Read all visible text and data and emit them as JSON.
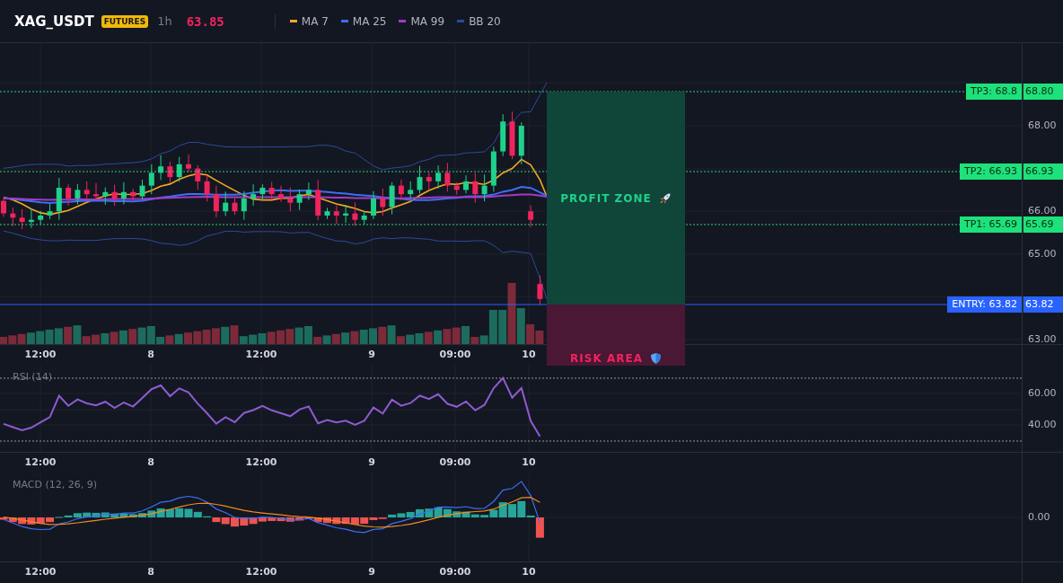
{
  "header": {
    "symbol": "XAG_USDT",
    "market_badge": "FUTURES",
    "interval": "1h",
    "price": {
      "value": "63.85",
      "falling": true
    }
  },
  "legend": [
    {
      "label": "MA 7",
      "color": "#f5a623"
    },
    {
      "label": "MA 25",
      "color": "#3d6ef5"
    },
    {
      "label": "MA 99",
      "color": "#a03cc4"
    },
    {
      "label": "BB 20",
      "color": "#2a4b9b"
    }
  ],
  "price_chart": {
    "price_axis": [
      "68.00",
      "66.00",
      "65.00",
      "63.00"
    ],
    "levels": [
      {
        "kind": "target",
        "label": "TP3: 68.8",
        "value": "68.80"
      },
      {
        "kind": "target",
        "label": "TP2: 66.93",
        "value": "66.93"
      },
      {
        "kind": "target",
        "label": "TP1: 65.69",
        "value": "65.69"
      },
      {
        "kind": "entry",
        "label": "ENTRY: 63.82",
        "value": "63.82"
      }
    ],
    "zones": [
      {
        "kind": "profit",
        "label": "PROFIT ZONE"
      },
      {
        "kind": "risk",
        "label": "RISK AREA"
      }
    ],
    "time_axis": [
      "12:00",
      "8",
      "12:00",
      "9",
      "09:00",
      "10"
    ]
  },
  "rsi": {
    "title": "RSI (14)",
    "axis": [
      "60.00",
      "40.00"
    ],
    "time_axis": [
      "12:00",
      "8",
      "12:00",
      "9",
      "09:00",
      "10"
    ]
  },
  "macd": {
    "title": "MACD (12, 26, 9)",
    "axis": [
      "0.00"
    ],
    "time_axis": [
      "12:00",
      "8",
      "12:00",
      "9",
      "09:00",
      "10"
    ]
  }
}
